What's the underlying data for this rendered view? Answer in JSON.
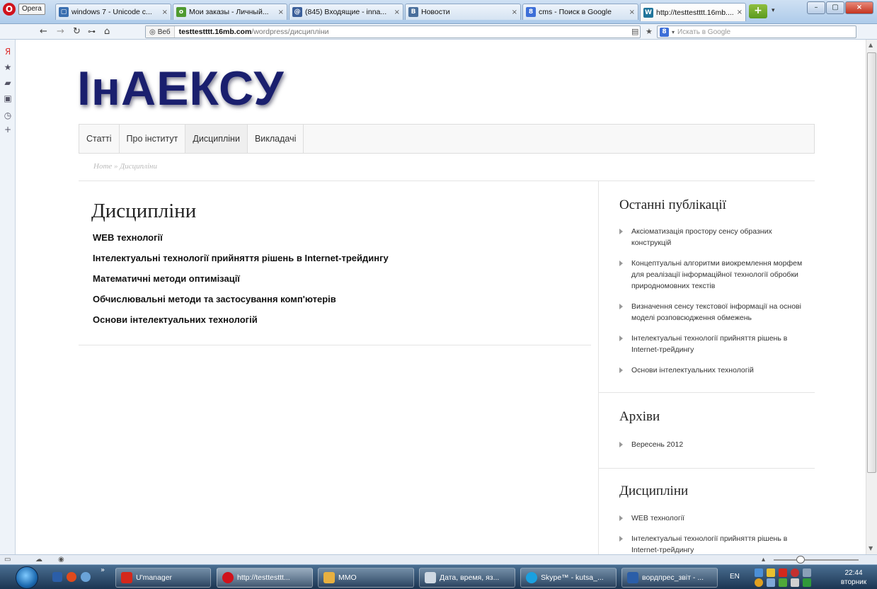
{
  "browser": {
    "opera_label": "Opera",
    "tabs": [
      {
        "title": "windows 7 - Unicode c...",
        "icon": "page-icon",
        "color": "#3a6fb0"
      },
      {
        "title": "Мои заказы - Личный...",
        "icon": "odesk-icon",
        "color": "#4f9a30"
      },
      {
        "title": "(845) Входящие - inna...",
        "icon": "mail-icon",
        "color": "#3b5f9a"
      },
      {
        "title": "Новости",
        "icon": "vk-icon",
        "color": "#4a6f9c"
      },
      {
        "title": "cms - Поиск в Google",
        "icon": "google-icon",
        "color": "#3d6fd8"
      },
      {
        "title": "http://testtestttt.16mb....",
        "icon": "wordpress-icon",
        "color": "#21759b"
      }
    ],
    "address": {
      "web_label": "Веб",
      "url_domain": "testtestttt.16mb.com",
      "url_path": "/wordpress/дисципліни",
      "url_prefix": "testtestttt."
    },
    "search_placeholder": "Искать в Google"
  },
  "site": {
    "logo": "ІнАЕКСУ",
    "menu": [
      "Статті",
      "Про інститут",
      "Дисципліни",
      "Викладачі"
    ],
    "breadcrumb": "Home » Дисципліни",
    "page_title": "Дисципліни",
    "posts": [
      "WEB технології",
      "Інтелектуальні технології прийняття рішень в Internet-трейдингу",
      "Математичні методи оптимізації",
      "Обчислювальні методи та застосування комп'ютерів",
      "Основи інтелектуальних технологій"
    ],
    "sidebar": {
      "recent_title": "Останні публікації",
      "recent": [
        "Аксіоматизація простору сенсу образних конструкцій",
        "Концептуальні алгоритми виокремлення морфем для реалізації інформаційної технології обробки природномовних текстів",
        "Визначення сенсу текстової інформації на основі моделі розповсюдження обмежень",
        "Інтелектуальні технології прийняття рішень в Internet-трейдингу",
        "Основи інтелектуальних технологій"
      ],
      "archives_title": "Архіви",
      "archives": [
        "Вересень 2012"
      ],
      "categories_title": "Дисципліни",
      "categories": [
        "WEB технології",
        "Інтелектуальні технології прийняття рішень в Internet-трейдингу"
      ]
    }
  },
  "taskbar": {
    "tasks": [
      {
        "label": "U'manager",
        "color": "#d4281c"
      },
      {
        "label": "http://testtesttt...",
        "color": "#d0121c"
      },
      {
        "label": "MMO",
        "color": "#e8b040"
      },
      {
        "label": "Дата, время, яз...",
        "color": "#cfd8e2"
      },
      {
        "label": "Skype™ - kutsa_...",
        "color": "#1aa0e0"
      },
      {
        "label": "вордпрес_звіт - ...",
        "color": "#2b5ea8"
      }
    ],
    "lang": "EN",
    "time": "22:44",
    "day": "вторник"
  }
}
